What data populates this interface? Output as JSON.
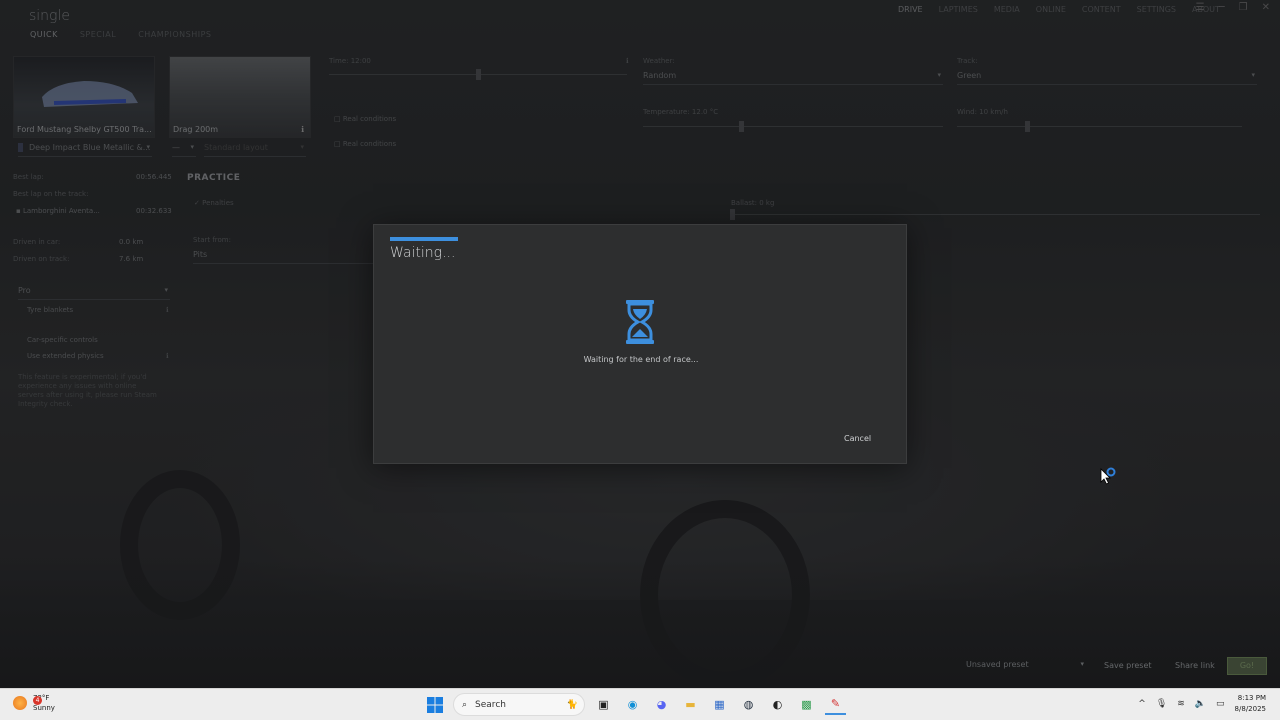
{
  "app": {
    "title": "single",
    "tabs": [
      {
        "label": "QUICK",
        "active": true
      },
      {
        "label": "SPECIAL",
        "active": false
      },
      {
        "label": "CHAMPIONSHIPS",
        "active": false
      }
    ],
    "top_nav": [
      {
        "label": "DRIVE",
        "active": true
      },
      {
        "label": "LAPTIMES",
        "active": false
      },
      {
        "label": "MEDIA",
        "active": false
      },
      {
        "label": "ONLINE",
        "active": false
      },
      {
        "label": "CONTENT",
        "active": false
      },
      {
        "label": "SETTINGS",
        "active": false
      },
      {
        "label": "ABOUT",
        "active": false
      }
    ]
  },
  "car": {
    "name": "Ford Mustang Shelby GT500 Tra...",
    "skin": "Deep Impact Blue Metallic &..."
  },
  "track": {
    "name": "Drag 200m",
    "layout_a": "—",
    "layout_b": "Standard layout"
  },
  "stats": {
    "best_lap_label": "Best lap:",
    "best_lap_value": "00:56.445",
    "best_lap_track_label": "Best lap on the track:",
    "best_lap_track_car": "Lamborghini Aventa...",
    "best_lap_track_value": "00:32.633",
    "driven_car_label": "Driven in car:",
    "driven_car_value": "0.0 km",
    "driven_track_label": "Driven on track:",
    "driven_track_value": "7.6 km"
  },
  "assists": {
    "preset": "Pro",
    "tyre_blankets": "Tyre blankets",
    "car_specific": "Car-specific controls",
    "extended_physics": "Use extended physics",
    "warning": "This feature is experimental; if you'd experience any issues with online servers after using it, please run Steam Integrity check."
  },
  "practice": {
    "heading": "PRACTICE",
    "penalties": "Penalties",
    "start_from_label": "Start from:",
    "start_from_value": "Pits",
    "ballast_label": "Ballast: 0 kg"
  },
  "conditions": {
    "time_label": "Time: 12:00",
    "real_conditions_1": "Real conditions",
    "real_conditions_2": "Real conditions",
    "weather_label": "Weather:",
    "weather_value": "Random",
    "temperature_label": "Temperature: 12.0 °C",
    "track_label": "Track:",
    "track_value": "Green",
    "wind_label": "Wind: 10 km/h"
  },
  "dialog": {
    "title": "Waiting...",
    "message": "Waiting for the end of race...",
    "cancel_label": "Cancel",
    "accent": "#3d8fde"
  },
  "bottom": {
    "preset": "Unsaved preset",
    "save_preset": "Save preset",
    "share_link": "Share link",
    "go": "Go!"
  },
  "taskbar": {
    "weather_temp": "72°F",
    "weather_desc": "Sunny",
    "weather_badge": "4",
    "search_placeholder": "Search",
    "time": "8:13 PM",
    "date": "8/8/2025"
  }
}
